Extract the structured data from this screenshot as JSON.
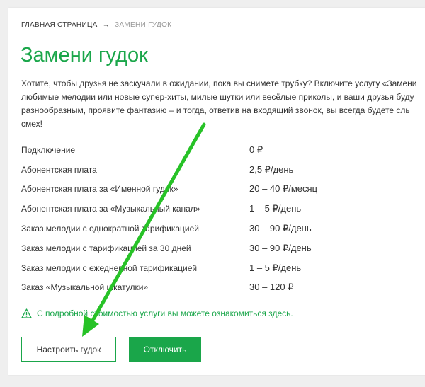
{
  "breadcrumb": {
    "home": "ГЛАВНАЯ СТРАНИЦА",
    "separator": "→",
    "current": "ЗАМЕНИ ГУДОК"
  },
  "page": {
    "title": "Замени гудок",
    "description_lines": [
      "Хотите, чтобы друзья не заскучали в ожидании, пока вы снимете трубку? Включите услугу «Замени",
      "любимые мелодии или новые супер-хиты, милые шутки или весёлые приколы, и ваши друзья буду",
      "разнообразным, проявите фантазию – и тогда, ответив на входящий звонок, вы всегда будете сль",
      "смех!"
    ]
  },
  "prices": [
    {
      "label": "Подключение",
      "value": "0 ₽"
    },
    {
      "label": "Абонентская плата",
      "value": "2,5 ₽/день"
    },
    {
      "label": "Абонентская плата за «Именной гудок»",
      "value": "20 – 40 ₽/месяц"
    },
    {
      "label": "Абонентская плата за «Музыкальный канал»",
      "value": "1 – 5 ₽/день"
    },
    {
      "label": "Заказ мелодии с однократной тарификацией",
      "value": "30 – 90 ₽/день"
    },
    {
      "label": "Заказ мелодии с тарификацией за 30 дней",
      "value": "30 – 90 ₽/день"
    },
    {
      "label": "Заказ мелодии с ежедневной тарификацией",
      "value": "1 – 5 ₽/день"
    },
    {
      "label": "Заказ «Музыкальной шкатулки»",
      "value": "30 – 120 ₽"
    }
  ],
  "note": {
    "icon": "warning-triangle-icon",
    "text": "С подробной стоимостью услуги вы можете ознакомиться здесь."
  },
  "buttons": {
    "configure": "Настроить гудок",
    "disable": "Отключить"
  },
  "colors": {
    "accent": "#1aa64a",
    "annotation_arrow": "#27c227"
  }
}
